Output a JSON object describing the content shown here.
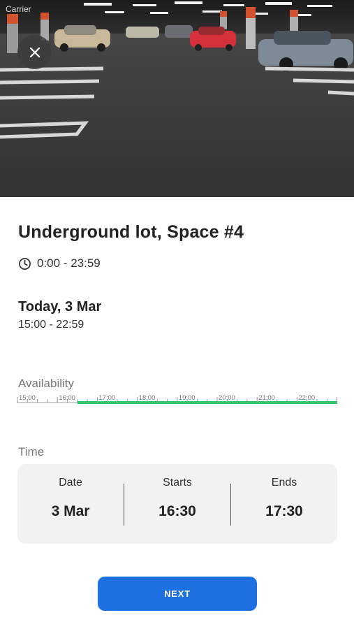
{
  "status_bar": {
    "carrier": "Carrier"
  },
  "header": {
    "close_icon": "close-icon"
  },
  "listing": {
    "title": "Underground lot, Space #4",
    "hours_icon": "clock-icon",
    "hours": "0:00 - 23:59"
  },
  "selection": {
    "day": "Today, 3 Mar",
    "range": "15:00 - 22:59"
  },
  "availability": {
    "label": "Availability",
    "ticks": [
      "15:00",
      "16:00",
      "17:00",
      "18:00",
      "19:00",
      "20:00",
      "21:00",
      "22:00"
    ],
    "available_from": "16:30",
    "colors": {
      "available": "#34c46b",
      "unavailable": "#cfcfcf"
    }
  },
  "time": {
    "label": "Time",
    "date_label": "Date",
    "date_value": "3 Mar",
    "starts_label": "Starts",
    "starts_value": "16:30",
    "ends_label": "Ends",
    "ends_value": "17:30"
  },
  "actions": {
    "next_label": "NEXT",
    "accent": "#1e6fe0"
  }
}
